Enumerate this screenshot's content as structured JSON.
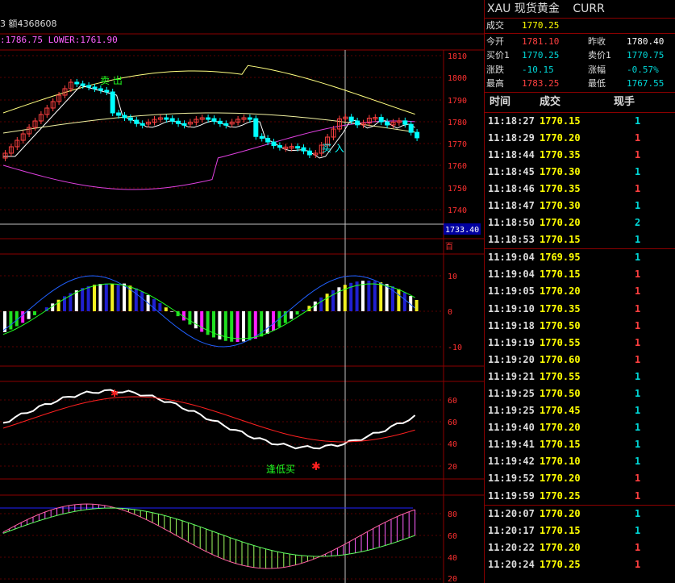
{
  "chart": {
    "info_line": "3 额4368608",
    "indicator_line": ":1786.75 LOWER:1761.90",
    "price_axis": [
      "1810",
      "1800",
      "1790",
      "1780",
      "1770",
      "1760",
      "1750",
      "1740"
    ],
    "price_low_label": "1733.40",
    "corner_label": "百",
    "macd_axis": [
      "10",
      "0",
      "-10"
    ],
    "kdj_axis": [
      "60",
      "40",
      "20",
      "60",
      "40",
      "20"
    ],
    "rsi_axis": [
      "80",
      "60",
      "40",
      "20"
    ],
    "annotations": {
      "sell": "卖 出",
      "buy": "买 入",
      "low_buy": "逢低买"
    },
    "colors": {
      "up_candle": "#ff4040",
      "down_candle": "#00ffff",
      "upper_band": "#ffff80",
      "lower_band": "#e040e0",
      "grid": "#8b0000",
      "axis_text": "#ff3030"
    }
  },
  "quote": {
    "code": "XAU",
    "name": "现货黄金",
    "suffix": "CURR",
    "last_label": "成交",
    "last_value": "1770.25",
    "rows": [
      {
        "l1": "今开",
        "v1": "1781.10",
        "c1": "red",
        "l2": "昨收",
        "v2": "1780.40",
        "c2": "white"
      },
      {
        "l1": "买价1",
        "v1": "1770.25",
        "c1": "cyan",
        "l2": "卖价1",
        "v2": "1770.75",
        "c2": "cyan"
      },
      {
        "l1": "涨跌",
        "v1": "-10.15",
        "c1": "cyan",
        "l2": "涨幅",
        "v2": "-0.57%",
        "c2": "cyan"
      },
      {
        "l1": "最高",
        "v1": "1783.25",
        "c1": "red",
        "l2": "最低",
        "v2": "1767.55",
        "c2": "cyan"
      }
    ]
  },
  "ticks": {
    "headers": {
      "time": "时间",
      "price": "成交",
      "volume": "现手"
    },
    "group1": [
      {
        "time": "11:18:27",
        "price": "1770.15",
        "vol": "1",
        "dir": "cyan"
      },
      {
        "time": "11:18:29",
        "price": "1770.20",
        "vol": "1",
        "dir": "red"
      },
      {
        "time": "11:18:44",
        "price": "1770.35",
        "vol": "1",
        "dir": "red"
      },
      {
        "time": "11:18:45",
        "price": "1770.30",
        "vol": "1",
        "dir": "cyan"
      },
      {
        "time": "11:18:46",
        "price": "1770.35",
        "vol": "1",
        "dir": "red"
      },
      {
        "time": "11:18:47",
        "price": "1770.30",
        "vol": "1",
        "dir": "cyan"
      },
      {
        "time": "11:18:50",
        "price": "1770.20",
        "vol": "2",
        "dir": "cyan"
      },
      {
        "time": "11:18:53",
        "price": "1770.15",
        "vol": "1",
        "dir": "cyan"
      }
    ],
    "group2": [
      {
        "time": "11:19:04",
        "price": "1769.95",
        "vol": "1",
        "dir": "cyan"
      },
      {
        "time": "11:19:04",
        "price": "1770.15",
        "vol": "1",
        "dir": "red"
      },
      {
        "time": "11:19:05",
        "price": "1770.20",
        "vol": "1",
        "dir": "red"
      },
      {
        "time": "11:19:10",
        "price": "1770.35",
        "vol": "1",
        "dir": "red"
      },
      {
        "time": "11:19:18",
        "price": "1770.50",
        "vol": "1",
        "dir": "red"
      },
      {
        "time": "11:19:19",
        "price": "1770.55",
        "vol": "1",
        "dir": "red"
      },
      {
        "time": "11:19:20",
        "price": "1770.60",
        "vol": "1",
        "dir": "red"
      },
      {
        "time": "11:19:21",
        "price": "1770.55",
        "vol": "1",
        "dir": "cyan"
      },
      {
        "time": "11:19:25",
        "price": "1770.50",
        "vol": "1",
        "dir": "cyan"
      },
      {
        "time": "11:19:25",
        "price": "1770.45",
        "vol": "1",
        "dir": "cyan"
      },
      {
        "time": "11:19:40",
        "price": "1770.20",
        "vol": "1",
        "dir": "cyan"
      },
      {
        "time": "11:19:41",
        "price": "1770.15",
        "vol": "1",
        "dir": "cyan"
      },
      {
        "time": "11:19:42",
        "price": "1770.10",
        "vol": "1",
        "dir": "cyan"
      },
      {
        "time": "11:19:52",
        "price": "1770.20",
        "vol": "1",
        "dir": "red"
      },
      {
        "time": "11:19:59",
        "price": "1770.25",
        "vol": "1",
        "dir": "red"
      }
    ],
    "group3": [
      {
        "time": "11:20:07",
        "price": "1770.20",
        "vol": "1",
        "dir": "cyan"
      },
      {
        "time": "11:20:17",
        "price": "1770.15",
        "vol": "1",
        "dir": "cyan"
      },
      {
        "time": "11:20:22",
        "price": "1770.20",
        "vol": "1",
        "dir": "red"
      },
      {
        "time": "11:20:24",
        "price": "1770.25",
        "vol": "1",
        "dir": "red"
      }
    ]
  }
}
